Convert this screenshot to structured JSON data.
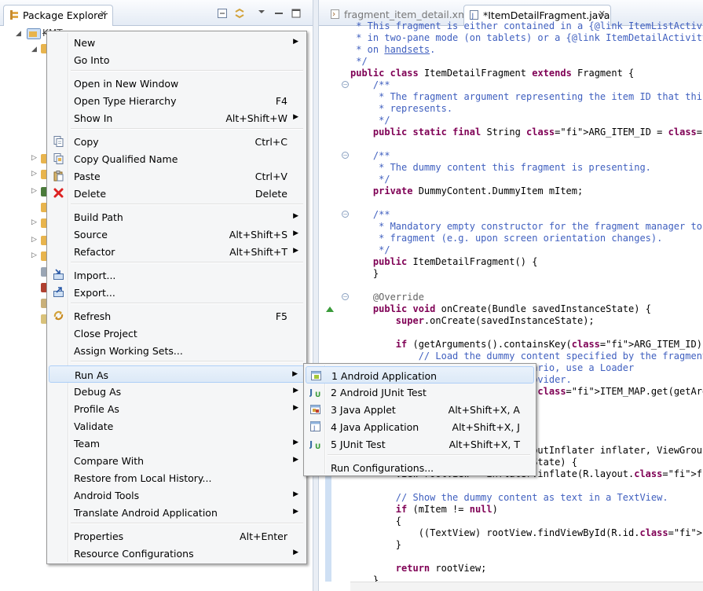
{
  "package_explorer": {
    "tab_label": "Package Explorer",
    "close_glyph": "✕",
    "project_label": "KMT"
  },
  "editor": {
    "tabs": [
      {
        "label": "fragment_item_detail.xml",
        "active": false
      },
      {
        "label": "*ItemDetailFragment.java",
        "active": true,
        "close_glyph": "✕"
      }
    ],
    "code_lines": [
      " * This fragment is either contained in a {@link ItemListActivity}",
      " * in two-pane mode (on tablets) or a {@link ItemDetailActivity}",
      " * on handsets.",
      " */",
      "public class ItemDetailFragment extends Fragment {",
      "    /**",
      "     * The fragment argument representing the item ID that this",
      "     * represents.",
      "     */",
      "    public static final String ARG_ITEM_ID = \"item_id\";",
      "",
      "    /**",
      "     * The dummy content this fragment is presenting.",
      "     */",
      "    private DummyContent.DummyItem mItem;",
      "",
      "    /**",
      "     * Mandatory empty constructor for the fragment manager to i",
      "     * fragment (e.g. upon screen orientation changes).",
      "     */",
      "    public ItemDetailFragment() {",
      "    }",
      "",
      "    @Override",
      "    public void onCreate(Bundle savedInstanceState) {",
      "        super.onCreate(savedInstanceState);",
      "",
      "        if (getArguments().containsKey(ARG_ITEM_ID)) {",
      "            // Load the dummy content specified by the fragment",
      "            // a real-world scenario, use a Loader",
      "            // from a content provider.",
      "            mItem = DummyContent.ITEM_MAP.get(getArguments().get",
      "        }",
      "    }",
      "",
      "    @Override",
      "    public View onCreateView(LayoutInflater inflater, ViewGroup",
      "            Bundle savedInstanceState) {",
      "        View rootView = inflater.inflate(R.layout.fragment_item_",
      "",
      "        // Show the dummy content as text in a TextView.",
      "        if (mItem != null)",
      "        {",
      "            ((TextView) rootView.findViewById(R.id.item_detail))",
      "        }",
      "",
      "        return rootView;",
      "    }"
    ]
  },
  "context_menu": {
    "items": [
      {
        "label": "New",
        "accel": "",
        "submenu": true
      },
      {
        "label": "Go Into",
        "accel": ""
      },
      {
        "label": "Open in New Window",
        "accel": ""
      },
      {
        "label": "Open Type Hierarchy",
        "accel": "F4"
      },
      {
        "label": "Show In",
        "accel": "Alt+Shift+W",
        "submenu": true
      },
      {
        "label": "Copy",
        "accel": "Ctrl+C",
        "icon": "copy-icon"
      },
      {
        "label": "Copy Qualified Name",
        "accel": "",
        "icon": "copy-qualified-icon"
      },
      {
        "label": "Paste",
        "accel": "Ctrl+V",
        "icon": "paste-icon"
      },
      {
        "label": "Delete",
        "accel": "Delete",
        "icon": "delete-icon"
      },
      {
        "label": "Build Path",
        "accel": "",
        "submenu": true
      },
      {
        "label": "Source",
        "accel": "Alt+Shift+S",
        "submenu": true
      },
      {
        "label": "Refactor",
        "accel": "Alt+Shift+T",
        "submenu": true
      },
      {
        "label": "Import...",
        "accel": "",
        "icon": "import-icon"
      },
      {
        "label": "Export...",
        "accel": "",
        "icon": "export-icon"
      },
      {
        "label": "Refresh",
        "accel": "F5",
        "icon": "refresh-icon"
      },
      {
        "label": "Close Project",
        "accel": ""
      },
      {
        "label": "Assign Working Sets...",
        "accel": ""
      },
      {
        "label": "Run As",
        "accel": "",
        "submenu": true,
        "highlighted": true
      },
      {
        "label": "Debug As",
        "accel": "",
        "submenu": true
      },
      {
        "label": "Profile As",
        "accel": "",
        "submenu": true
      },
      {
        "label": "Validate",
        "accel": ""
      },
      {
        "label": "Team",
        "accel": "",
        "submenu": true
      },
      {
        "label": "Compare With",
        "accel": "",
        "submenu": true
      },
      {
        "label": "Restore from Local History...",
        "accel": ""
      },
      {
        "label": "Android Tools",
        "accel": "",
        "submenu": true
      },
      {
        "label": "Translate Android Application",
        "accel": "",
        "submenu": true
      },
      {
        "label": "Properties",
        "accel": "Alt+Enter"
      },
      {
        "label": "Resource Configurations",
        "accel": "",
        "submenu": true
      }
    ]
  },
  "run_as_submenu": {
    "items": [
      {
        "label": "1 Android Application",
        "accel": "",
        "icon": "android-app-icon",
        "highlighted": true
      },
      {
        "label": "2 Android JUnit Test",
        "accel": "",
        "icon": "junit-icon"
      },
      {
        "label": "3 Java Applet",
        "accel": "Alt+Shift+X, A",
        "icon": "java-applet-icon"
      },
      {
        "label": "4 Java Application",
        "accel": "Alt+Shift+X, J",
        "icon": "java-app-icon"
      },
      {
        "label": "5 JUnit Test",
        "accel": "Alt+Shift+X, T",
        "icon": "junit-icon"
      },
      {
        "label": "Run Configurations...",
        "accel": ""
      }
    ]
  },
  "colors": {
    "menu_highlight": "#dce9f7",
    "keyword": "#7f0055",
    "comment": "#3f5fbf",
    "string": "#2a00ff",
    "field": "#0000c0"
  }
}
